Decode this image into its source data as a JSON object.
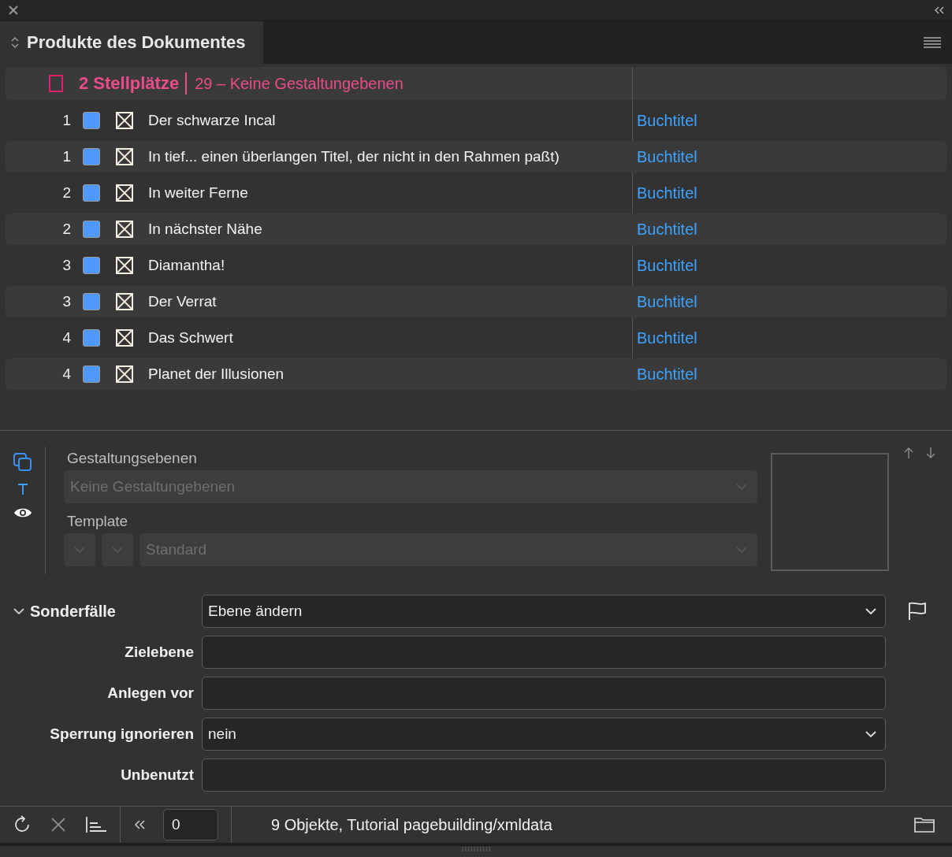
{
  "panel": {
    "tab": "Produkte des Dokumentes"
  },
  "group": {
    "title": "2 Stellplätze",
    "detail": "29 – Keine Gestaltungebenen"
  },
  "rows": [
    {
      "number": "1",
      "color": "#4f99fd",
      "title": "Der schwarze Incal",
      "type": "Buchtitel"
    },
    {
      "number": "1",
      "color": "#4f99fd",
      "title": "In tief... einen überlangen Titel, der nicht in den Rahmen paßt)",
      "type": "Buchtitel"
    },
    {
      "number": "2",
      "color": "#4f99fd",
      "title": "In weiter Ferne",
      "type": "Buchtitel"
    },
    {
      "number": "2",
      "color": "#4f99fd",
      "title": "In nächster Nähe",
      "type": "Buchtitel"
    },
    {
      "number": "3",
      "color": "#4f99fd",
      "title": "Diamantha!",
      "type": "Buchtitel"
    },
    {
      "number": "3",
      "color": "#4f99fd",
      "title": "Der Verrat",
      "type": "Buchtitel"
    },
    {
      "number": "4",
      "color": "#4f99fd",
      "title": "Das Schwert",
      "type": "Buchtitel"
    },
    {
      "number": "4",
      "color": "#4f99fd",
      "title": "Planet der Illusionen",
      "type": "Buchtitel"
    }
  ],
  "details": {
    "layers_label": "Gestaltungsebenen",
    "layers_select": {
      "value": "Keine Gestaltungebenen",
      "disabled": true
    },
    "template_label": "Template",
    "template_selects": [
      {
        "disabled": true
      },
      {
        "disabled": true
      },
      {
        "value": "Standard",
        "disabled": true
      }
    ]
  },
  "special": {
    "title": "Sonderfälle",
    "expanded": true,
    "action": "Ebene ändern",
    "fields": [
      {
        "label": "Zielebene",
        "kind": "input"
      },
      {
        "label": "Anlegen vor",
        "kind": "input"
      },
      {
        "label": "Sperrung ignorieren",
        "kind": "select",
        "value": "nein"
      },
      {
        "label": "Unbenutzt",
        "kind": "input"
      }
    ]
  },
  "toolbar": {
    "page": "0",
    "status": "9 Objekte, Tutorial pagebuilding/xmldata"
  }
}
